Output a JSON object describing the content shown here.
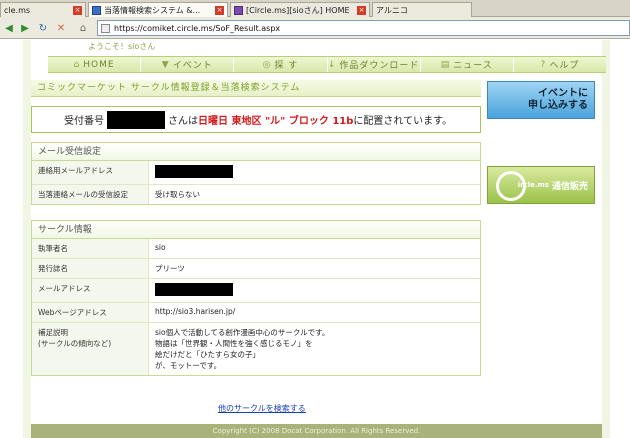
{
  "browser": {
    "tabs": [
      {
        "label": "cle.ms",
        "favicon": "page",
        "active": false
      },
      {
        "label": "当落情報検索システム &...",
        "favicon": "blue",
        "active": true
      },
      {
        "label": "[Circle.ms][sioさん] HOME",
        "favicon": "purple",
        "active": false
      },
      {
        "label": "アルニコ",
        "favicon": "page",
        "active": false
      }
    ],
    "url": "https://comiket.circle.ms/SoF_Result.aspx"
  },
  "header": {
    "welcome": "ようこそ！sioさん"
  },
  "nav": {
    "items": [
      {
        "label": "HOME",
        "icon": "home-icon",
        "glyph": "⌂"
      },
      {
        "label": "イベント",
        "icon": "event-icon",
        "glyph": "▼"
      },
      {
        "label": "探 す",
        "icon": "search-icon",
        "glyph": "◎"
      },
      {
        "label": "作品ダウンロード",
        "icon": "download-icon",
        "glyph": "↓"
      },
      {
        "label": "ニュース",
        "icon": "news-icon",
        "glyph": "▤"
      },
      {
        "label": "ヘルプ",
        "icon": "help-icon",
        "glyph": "?"
      }
    ]
  },
  "main": {
    "heading": "コミックマーケット サークル情報登録＆当落検索システム",
    "result": {
      "prefix": "受付番号",
      "mid": "さんは",
      "highlight": "日曜日 東地区 \"ル\" ブロック 11b",
      "suffix": "に配置されています。"
    },
    "mail_section": {
      "title": "メール受信設定",
      "rows": [
        {
          "label": "連絡用メールアドレス",
          "value": "",
          "redacted": true
        },
        {
          "label": "当落連絡メールの受信設定",
          "value": "受け取らない",
          "redacted": false
        }
      ]
    },
    "circle_section": {
      "title": "サークル情報",
      "rows": [
        {
          "label": "執筆者名",
          "value": "sio",
          "redacted": false
        },
        {
          "label": "発行誌名",
          "value": "プリーツ",
          "redacted": false
        },
        {
          "label": "メールアドレス",
          "value": "",
          "redacted": true
        },
        {
          "label": "Webページアドレス",
          "value": "http://sio3.harisen.jp/",
          "redacted": false
        },
        {
          "label": "補足説明\n(サークルの傾向など)",
          "value": "sio個人で活動してる創作漫画中心のサークルです。\n物語は「世界観・人間性を強く感じるモノ」を\n絵だけだと「ひたすら女の子」\nが、モットーです。",
          "redacted": false
        }
      ]
    },
    "search_link": "他のサークルを検索する"
  },
  "sidebar": {
    "event_banner_lines": [
      "イベントに",
      "申し込みする"
    ],
    "shop_banner": "通信販売",
    "shop_banner_brand": "ircle.ms"
  },
  "footer": {
    "copyright": "Copyright (C) 2008 Docat Corporation. All Rights Reserved."
  }
}
